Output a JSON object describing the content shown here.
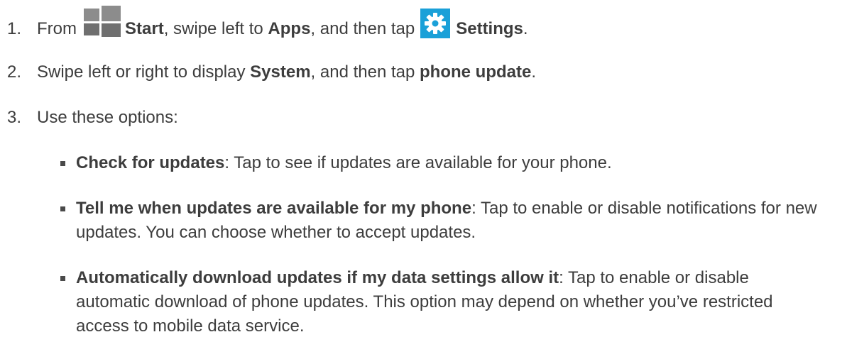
{
  "steps": [
    {
      "number": "1.",
      "part1": "From",
      "start_label": "Start",
      "part2": ", swipe left to",
      "apps_label": "Apps",
      "part3": ", and then tap",
      "settings_label": "Settings",
      "part4": ".",
      "icons": [
        "windows-start-tile-icon",
        "settings-gear-icon"
      ],
      "settings_icon_color": "#1aa0d8"
    },
    {
      "number": "2.",
      "part1": "Swipe left or right to display",
      "system_label": "System",
      "part2": ", and then tap",
      "phone_update_label": "phone update",
      "part3": "."
    },
    {
      "number": "3.",
      "text": "Use these options:"
    }
  ],
  "options": [
    {
      "title": "Check for updates",
      "description": ": Tap to see if updates are available for your phone."
    },
    {
      "title": "Tell me when updates are available for my phone",
      "description": ": Tap to enable or disable notifications for new updates. You can choose whether to accept updates."
    },
    {
      "title": "Automatically download updates if my data settings allow it",
      "description": ": Tap to enable or disable automatic download of phone updates. This option may depend on whether you’ve restricted access to mobile data service."
    }
  ]
}
